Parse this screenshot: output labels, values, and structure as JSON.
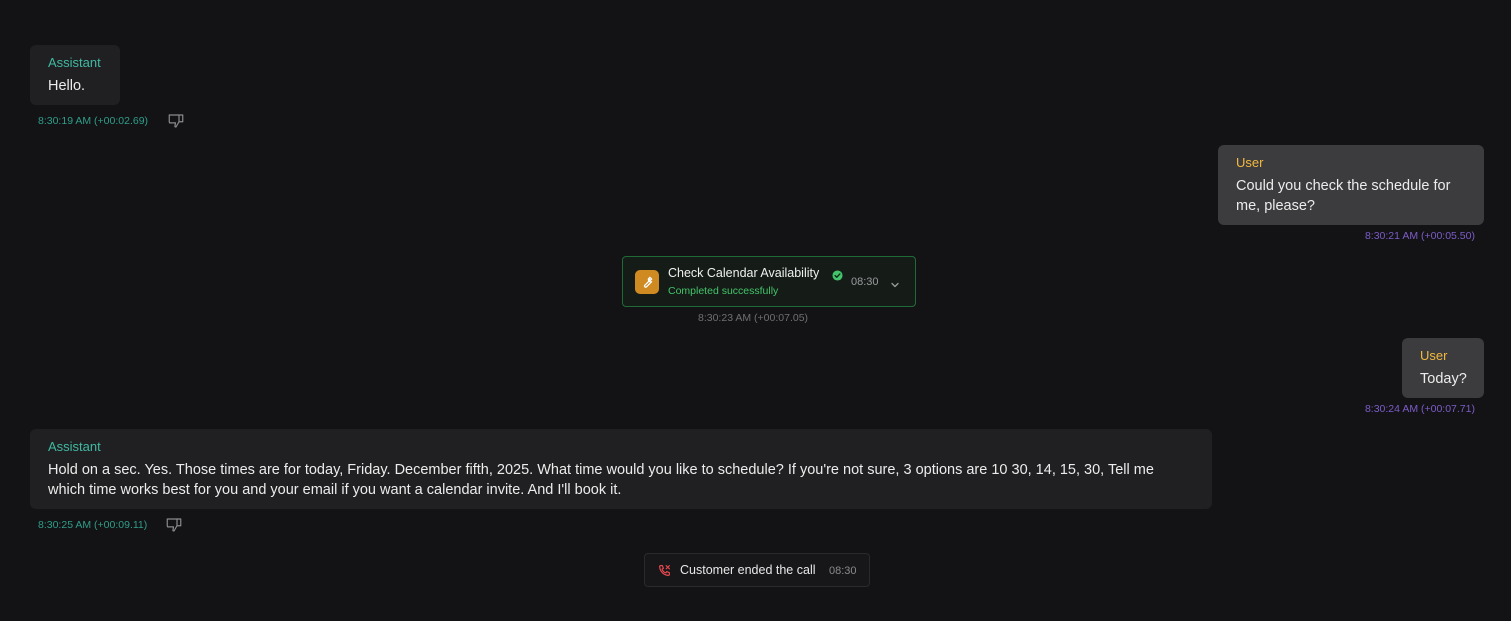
{
  "messages": [
    {
      "role": "Assistant",
      "text": "Hello.",
      "timestamp": "8:30:19 AM (+00:02.69)",
      "feedback_icon": "thumbs-down-icon"
    },
    {
      "role": "User",
      "text": "Could you check the schedule for me, please?",
      "timestamp": "8:30:21 AM (+00:05.50)"
    },
    {
      "role": "User",
      "text": "Today?",
      "timestamp": "8:30:24 AM (+00:07.71)"
    },
    {
      "role": "Assistant",
      "text": "Hold on a sec. Yes. Those times are for today, Friday. December fifth, 2025. What time would you like to schedule? If you're not sure, 3 options are 10 30, 14, 15, 30, Tell me which time works best for you and your email if you want a calendar invite. And I'll book it.",
      "timestamp": "8:30:25 AM (+00:09.11)",
      "feedback_icon": "thumbs-down-icon"
    }
  ],
  "tool_call": {
    "name": "Check Calendar Availability",
    "status": "Completed successfully",
    "time": "08:30",
    "timestamp": "8:30:23 AM (+00:07.05)",
    "icon": "wrench-icon",
    "status_icon": "check-circle-icon",
    "expand_icon": "chevron-down-icon"
  },
  "call_end": {
    "text": "Customer ended the call",
    "time": "08:30",
    "icon": "phone-hangup-icon"
  },
  "colors": {
    "background": "#131315",
    "assistant_label": "#3fb9a2",
    "user_label": "#f3b93e",
    "user_meta": "#7c5cc9",
    "success": "#43c46a",
    "tool_icon_bg": "#d08a22",
    "hangup": "#e5484d"
  }
}
